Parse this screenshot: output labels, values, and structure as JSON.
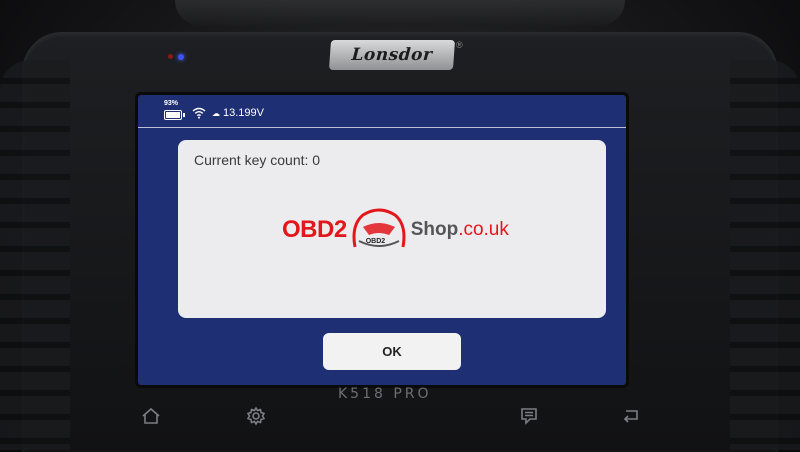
{
  "device": {
    "brand": "Lonsdor",
    "model": "K518 PRO"
  },
  "statusbar": {
    "battery_percent": "93%",
    "voltage": "13.199V",
    "icons": [
      "battery-icon",
      "wifi-icon",
      "car-battery-icon"
    ]
  },
  "dialog": {
    "message": "Current key count: 0",
    "ok_label": "OK"
  },
  "watermark": {
    "left": "OBD2",
    "badge": "OBD2",
    "right": "Shop",
    "tld": ".co.uk"
  },
  "navbar": {
    "icons": [
      "home-icon",
      "settings-icon",
      "notes-icon",
      "back-icon"
    ]
  },
  "colors": {
    "screen_bg": "#1f2f73",
    "dialog_bg": "#ececee",
    "watermark_red": "#e3171b"
  }
}
